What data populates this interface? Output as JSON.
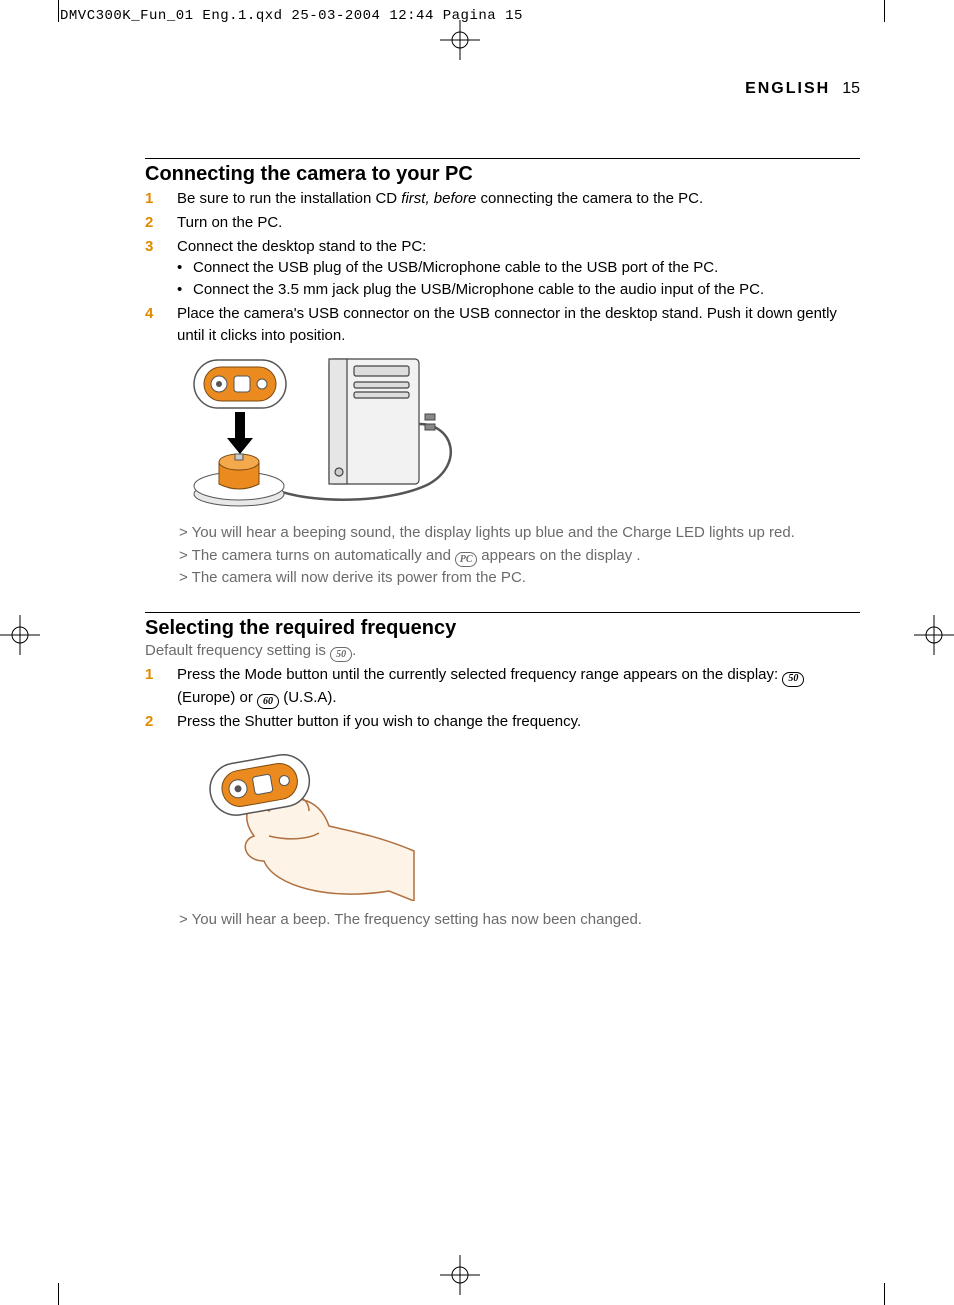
{
  "header": {
    "slug": "DMVC300K_Fun_01 Eng.1.qxd  25-03-2004  12:44  Pagina 15"
  },
  "running_head": {
    "language": "ENGLISH",
    "page_number": "15"
  },
  "section1": {
    "title": "Connecting the camera to your PC",
    "steps": [
      {
        "num": "1",
        "pre": "Be sure to run the installation CD ",
        "em": "first, before",
        "post": " connecting the camera to the PC."
      },
      {
        "num": "2",
        "text": "Turn on the PC."
      },
      {
        "num": "3",
        "text": "Connect the desktop stand to the PC:",
        "subs": [
          "Connect the USB plug of the USB/Microphone cable to the USB port of the PC.",
          "Connect the 3.5 mm jack plug the USB/Microphone cable to the audio input of the PC."
        ]
      },
      {
        "num": "4",
        "text": "Place the camera's USB connector on the USB connector in the desktop stand. Push it down gently until it clicks into position."
      }
    ],
    "notes": {
      "n1": "You will hear a beeping sound, the display lights up blue and the Charge LED lights up red.",
      "n2_pre": "The camera turns on automatically and ",
      "n2_icon": "PC",
      "n2_post": " appears on the display .",
      "n3": "The camera will now derive its power from the PC."
    }
  },
  "section2": {
    "title": "Selecting the required frequency",
    "intro_pre": "Default frequency setting is ",
    "intro_icon": "50",
    "intro_post": ".",
    "steps": [
      {
        "num": "1",
        "pre": "Press the Mode button until the currently selected frequency range appears on the display:  ",
        "icon1": "50",
        "mid": "  (Europe) or ",
        "icon2": "60",
        "post": " (U.S.A)."
      },
      {
        "num": "2",
        "text": "Press the Shutter button if you wish to change the frequency."
      }
    ],
    "notes": {
      "n1": "You will hear a beep. The frequency setting has now been changed."
    }
  }
}
